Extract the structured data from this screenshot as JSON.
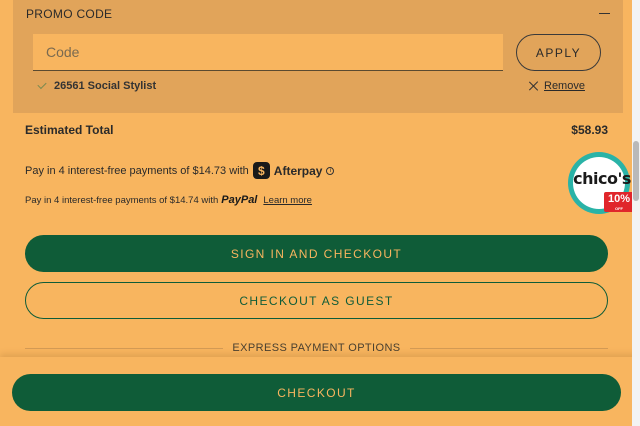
{
  "promo": {
    "header": "PROMO CODE",
    "input_placeholder": "Code",
    "input_value": "",
    "apply_label": "APPLY",
    "applied_code": "26561 Social Stylist",
    "remove_label": "Remove"
  },
  "totals": {
    "estimated_label": "Estimated Total",
    "estimated_value": "$58.93"
  },
  "afterpay": {
    "text": "Pay in 4 interest-free payments of $14.73 with",
    "badge": "$",
    "brand": "Afterpay",
    "info_glyph": "i"
  },
  "paypal": {
    "text": "Pay in 4 interest-free payments of $14.74 with",
    "brand": "PayPal",
    "learn_more": "Learn more"
  },
  "buttons": {
    "sign_in_checkout": "SIGN IN AND CHECKOUT",
    "checkout_guest": "CHECKOUT AS GUEST",
    "express_label": "EXPRESS PAYMENT OPTIONS",
    "checkout": "CHECKOUT"
  },
  "promo_badge": {
    "brand": "chico's",
    "discount": "10%",
    "discount_sub": "OFF"
  },
  "colors": {
    "background": "#f8b55f",
    "promo_panel": "#e1a45a",
    "primary_green": "#0f5c38",
    "badge_teal": "#2ab3a7",
    "badge_red": "#e0262b"
  }
}
